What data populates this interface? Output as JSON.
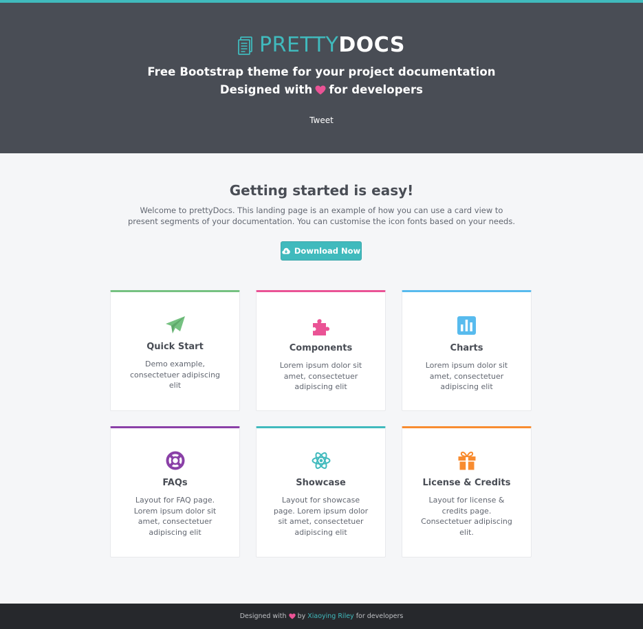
{
  "header": {
    "logo_light": "PRETTY",
    "logo_bold": "DOCS",
    "tagline_line1": "Free Bootstrap theme for your project documentation",
    "tagline_line2_prefix": "Designed with",
    "tagline_line2_suffix": "for developers",
    "tweet_label": "Tweet"
  },
  "intro": {
    "title": "Getting started is easy!",
    "text": "Welcome to prettyDocs. This landing page is an example of how you can use a card view to present segments of your documentation. You can customise the icon fonts based on your needs.",
    "download_label": "Download Now"
  },
  "cards": [
    {
      "title": "Quick Start",
      "desc": "Demo example, consectetuer adipiscing elit",
      "color": "#75c181",
      "icon": "paper-plane-icon"
    },
    {
      "title": "Components",
      "desc": "Lorem ipsum dolor sit amet, consectetuer adipiscing elit",
      "color": "#ea5395",
      "icon": "puzzle-piece-icon"
    },
    {
      "title": "Charts",
      "desc": "Lorem ipsum dolor sit amet, consectetuer adipiscing elit",
      "color": "#58bbee",
      "icon": "bar-chart-icon"
    },
    {
      "title": "FAQs",
      "desc": "Layout for FAQ page. Lorem ipsum dolor sit amet, consectetuer adipiscing elit",
      "color": "#8a40a7",
      "icon": "life-ring-icon"
    },
    {
      "title": "Showcase",
      "desc": "Layout for showcase page. Lorem ipsum dolor sit amet, consectetuer adipiscing elit",
      "color": "#40babd",
      "icon": "atom-icon"
    },
    {
      "title": "License & Credits",
      "desc": "Layout for license & credits page. Consectetuer adipiscing elit.",
      "color": "#f88c30",
      "icon": "gift-icon"
    }
  ],
  "footer": {
    "prefix": "Designed with",
    "by": "by",
    "author": "Xiaoying Riley",
    "suffix": "for developers"
  },
  "colors": {
    "accent": "#40babd",
    "heart": "#ea5395",
    "header_bg": "#494d55",
    "footer_bg": "#26282c"
  }
}
